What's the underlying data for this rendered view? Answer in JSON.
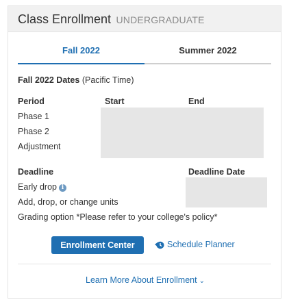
{
  "header": {
    "title": "Class Enrollment",
    "subtitle": "UNDERGRADUATE"
  },
  "tabs": [
    {
      "label": "Fall 2022",
      "active": true
    },
    {
      "label": "Summer 2022",
      "active": false
    }
  ],
  "dates": {
    "title_bold": "Fall 2022 Dates",
    "title_note": "(Pacific Time)",
    "col_period": "Period",
    "col_start": "Start",
    "col_end": "End",
    "periods": [
      "Phase 1",
      "Phase 2",
      "Adjustment"
    ]
  },
  "deadlines": {
    "col_deadline": "Deadline",
    "col_date": "Deadline Date",
    "rows": [
      "Early drop",
      "Add, drop, or change units",
      "Grading option *Please refer to your college's policy*"
    ]
  },
  "actions": {
    "enrollment_center": "Enrollment Center",
    "schedule_planner": "Schedule Planner",
    "learn_more": "Learn More About Enrollment"
  },
  "icons": {
    "info": "info-icon",
    "planner": "schedule-planner-icon",
    "chevron": "chevron-down-icon"
  },
  "colors": {
    "accent": "#1f6fb2",
    "placeholder": "#e6e6e6",
    "header_bg": "#f1f1f1"
  }
}
